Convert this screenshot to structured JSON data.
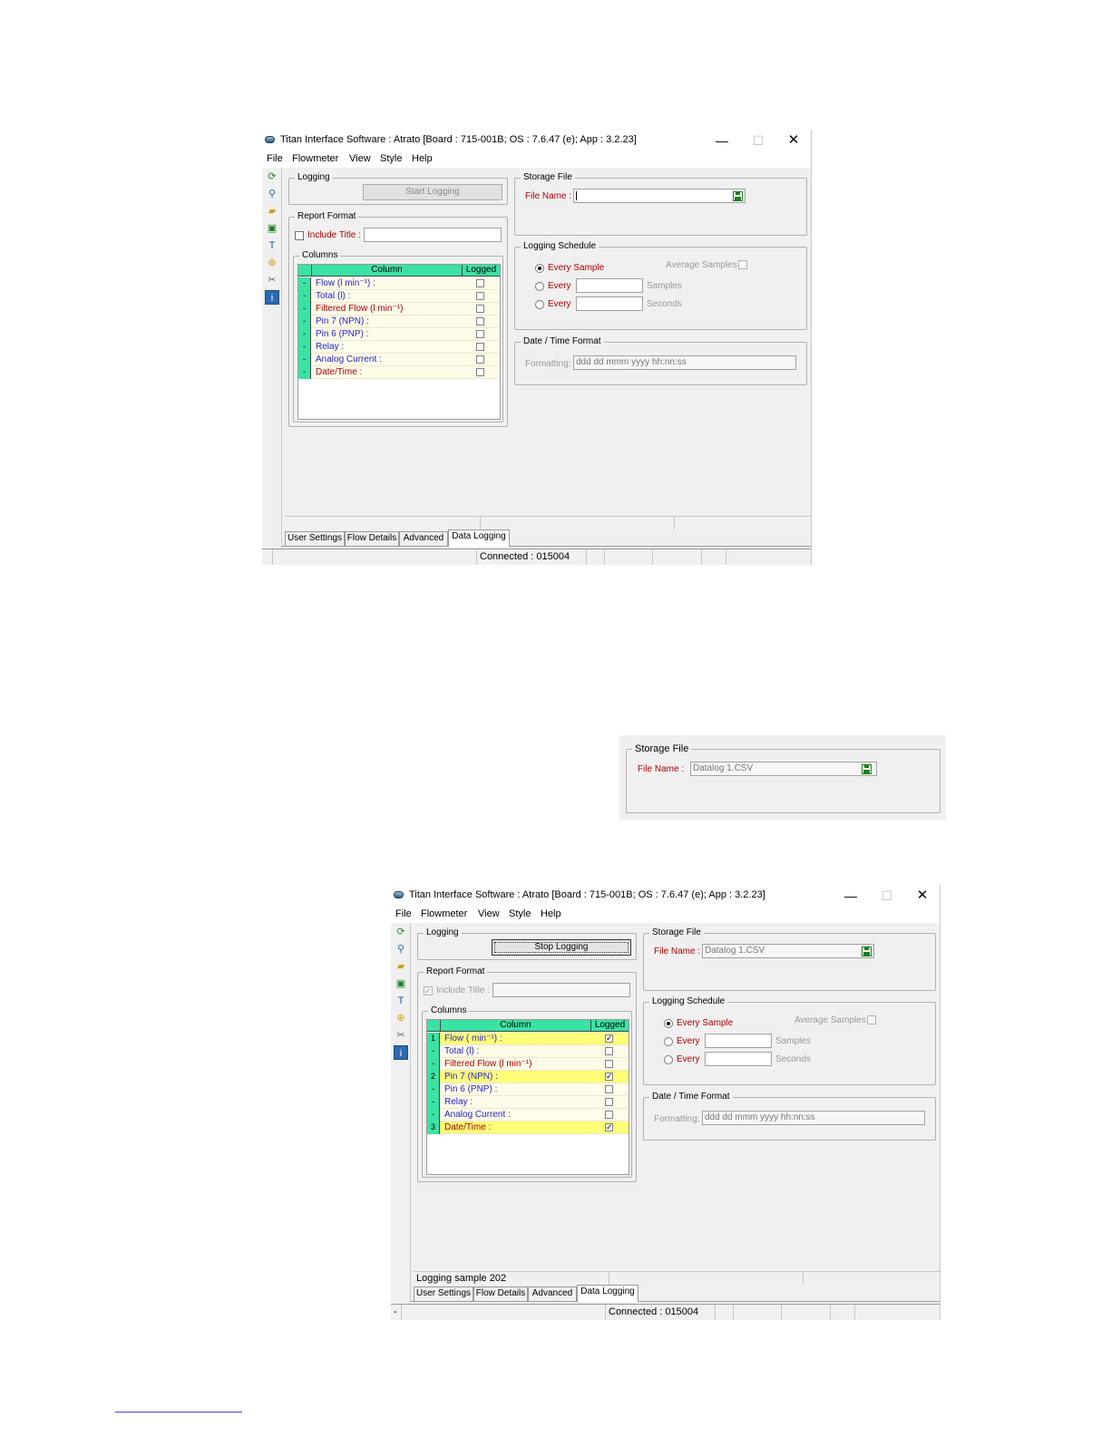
{
  "window1": {
    "title": "Titan Interface Software : Atrato [Board : 715-001B; OS : 7.6.47 (e); App : 3.2.23]",
    "window_controls": {
      "minimize": "—",
      "maximize": "☐",
      "close": "✕"
    },
    "menu": [
      "File",
      "Flowmeter",
      "View",
      "Style",
      "Help"
    ],
    "toolbar_icons": [
      "refresh-icon",
      "search-icon",
      "open-folder-icon",
      "save-icon",
      "probe-icon",
      "lock-icon",
      "tools-icon",
      "info-icon"
    ],
    "logging": {
      "title": "Logging",
      "button_label": "Start Logging"
    },
    "report_format": {
      "title": "Report Format",
      "include_title_label": "Include Title :",
      "include_title_checked": false,
      "include_title_value": ""
    },
    "columns": {
      "title": "Columns",
      "header_column": "Column",
      "header_logged": "Logged",
      "rows": [
        {
          "idx": "-",
          "name": "Flow (l min⁻¹) :",
          "color": "#1f1fd0",
          "logged": false
        },
        {
          "idx": "-",
          "name": "Total (l) :",
          "color": "#1f1fd0",
          "logged": false
        },
        {
          "idx": "-",
          "name": "Filtered Flow (l min⁻¹)",
          "color": "#b00000",
          "logged": false
        },
        {
          "idx": "-",
          "name": "Pin 7 (NPN) :",
          "color": "#1f1fd0",
          "logged": false
        },
        {
          "idx": "-",
          "name": "Pin 6 (PNP) :",
          "color": "#1f1fd0",
          "logged": false
        },
        {
          "idx": "-",
          "name": "Relay :",
          "color": "#1f1fd0",
          "logged": false
        },
        {
          "idx": "-",
          "name": "Analog Current :",
          "color": "#1f1fd0",
          "logged": false
        },
        {
          "idx": "-",
          "name": "Date/Time :",
          "color": "#b00000",
          "logged": false
        }
      ]
    },
    "storage_file": {
      "title": "Storage File",
      "label": "File Name :",
      "value": ""
    },
    "logging_schedule": {
      "title": "Logging Schedule",
      "every_sample": "Every Sample",
      "average_samples": "Average Samples",
      "every": "Every",
      "samples": "Samples",
      "seconds": "Seconds"
    },
    "datetime_format": {
      "title": "Date / Time Format",
      "label": "Formatting:",
      "value": "ddd dd mmm yyyy hh:nn:ss"
    },
    "status_text": "",
    "tabs": [
      "User Settings",
      "Flow Details",
      "Advanced",
      "Data Logging"
    ],
    "active_tab": "Data Logging",
    "connection": "Connected : 015004",
    "bottom_left": ""
  },
  "storage_crop": {
    "title": "Storage File",
    "label": "File Name :",
    "value": "Datalog 1.CSV"
  },
  "window2": {
    "title": "Titan Interface Software : Atrato [Board : 715-001B; OS : 7.6.47 (e); App : 3.2.23]",
    "window_controls": {
      "minimize": "—",
      "maximize": "☐",
      "close": "✕"
    },
    "menu": [
      "File",
      "Flowmeter",
      "View",
      "Style",
      "Help"
    ],
    "logging": {
      "title": "Logging",
      "button_label": "Stop Logging"
    },
    "report_format": {
      "title": "Report Format",
      "include_title_label": "Include Title :",
      "include_title_checked": true,
      "include_title_value": ""
    },
    "columns": {
      "title": "Columns",
      "header_column": "Column",
      "header_logged": "Logged",
      "rows": [
        {
          "idx": "1",
          "name": "Flow ( min⁻¹) :",
          "color": "#1f1fd0",
          "logged": true,
          "highlight": true
        },
        {
          "idx": "-",
          "name": "Total (l) :",
          "color": "#1f1fd0",
          "logged": false,
          "highlight": false
        },
        {
          "idx": "-",
          "name": "Filtered Flow (l min⁻¹)",
          "color": "#b00000",
          "logged": false,
          "highlight": false
        },
        {
          "idx": "2",
          "name": "Pin 7 (NPN) :",
          "color": "#1f1fd0",
          "logged": true,
          "highlight": true
        },
        {
          "idx": "-",
          "name": "Pin 6 (PNP) :",
          "color": "#1f1fd0",
          "logged": false,
          "highlight": false
        },
        {
          "idx": "-",
          "name": "Relay :",
          "color": "#1f1fd0",
          "logged": false,
          "highlight": false
        },
        {
          "idx": "-",
          "name": "Analog Current :",
          "color": "#1f1fd0",
          "logged": false,
          "highlight": false
        },
        {
          "idx": "3",
          "name": "Date/Time :",
          "color": "#b00000",
          "logged": true,
          "highlight": true
        }
      ]
    },
    "storage_file": {
      "title": "Storage File",
      "label": "File Name :",
      "value": "Datalog 1.CSV"
    },
    "logging_schedule": {
      "title": "Logging Schedule",
      "every_sample": "Every Sample",
      "average_samples": "Average Samples",
      "every": "Every",
      "samples": "Samples",
      "seconds": "Seconds"
    },
    "datetime_format": {
      "title": "Date / Time Format",
      "label": "Formatting:",
      "value": "ddd dd mmm yyyy hh:nn:ss"
    },
    "status_text": "Logging sample 202",
    "tabs": [
      "User Settings",
      "Flow Details",
      "Advanced",
      "Data Logging"
    ],
    "active_tab": "Data Logging",
    "connection": "Connected : 015004",
    "bottom_left": "-"
  }
}
